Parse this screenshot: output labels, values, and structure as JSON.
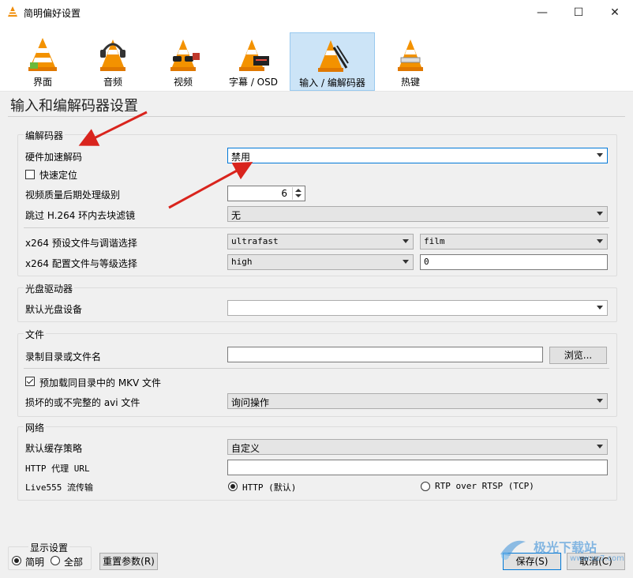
{
  "window": {
    "title": "简明偏好设置",
    "min": "—",
    "max": "☐",
    "close": "✕"
  },
  "toolbar": {
    "items": [
      {
        "label": "界面",
        "icon": "cone-interface-icon"
      },
      {
        "label": "音频",
        "icon": "cone-headphones-icon"
      },
      {
        "label": "视频",
        "icon": "cone-glasses-icon"
      },
      {
        "label": "字幕 / OSD",
        "icon": "cone-subtitle-icon"
      },
      {
        "label": "输入 / 编解码器",
        "icon": "cone-input-codec-icon"
      },
      {
        "label": "热键",
        "icon": "cone-hotkeys-icon"
      }
    ],
    "active": "输入 / 编解码器"
  },
  "page_title": "输入和编解码器设置",
  "codecs": {
    "title": "编解码器",
    "hw_decode_label": "硬件加速解码",
    "hw_decode_value": "禁用",
    "fast_seek_label": "快速定位",
    "postproc_label": "视频质量后期处理级别",
    "postproc_value": "6",
    "skip_h264_label": "跳过 H.264 环内去块滤镜",
    "skip_h264_value": "无",
    "x264_preset_label": "x264 预设文件与调谐选择",
    "x264_preset_value": "ultrafast",
    "x264_tune_value": "film",
    "x264_profile_label": "x264 配置文件与等级选择",
    "x264_profile_value": "high",
    "x264_level_value": "0"
  },
  "optical": {
    "title": "光盘驱动器",
    "default_device_label": "默认光盘设备",
    "default_device_value": ""
  },
  "files": {
    "title": "文件",
    "record_dir_label": "录制目录或文件名",
    "record_dir_value": "",
    "browse_label": "浏览...",
    "preload_mkv_label": "预加载同目录中的 MKV 文件",
    "broken_avi_label": "损坏的或不完整的 avi 文件",
    "broken_avi_value": "询问操作"
  },
  "network": {
    "title": "网络",
    "cache_label": "默认缓存策略",
    "cache_value": "自定义",
    "http_proxy_label": "HTTP 代理 URL",
    "http_proxy_value": "",
    "live555_label": "Live555 流传输",
    "http_option": "HTTP (默认)",
    "rtsp_option": "RTP over RTSP (TCP)"
  },
  "footer": {
    "show_settings_title": "显示设置",
    "simple_label": "简明",
    "all_label": "全部",
    "reset_label": "重置参数(R)",
    "save_label": "保存(S)",
    "cancel_label": "取消(C)"
  },
  "watermark": {
    "text": "极光下载站",
    "url": "www.xz7.com"
  },
  "colors": {
    "active_tab": "#cce4f7",
    "arrow": "#d9241d",
    "focus": "#0078d7"
  }
}
